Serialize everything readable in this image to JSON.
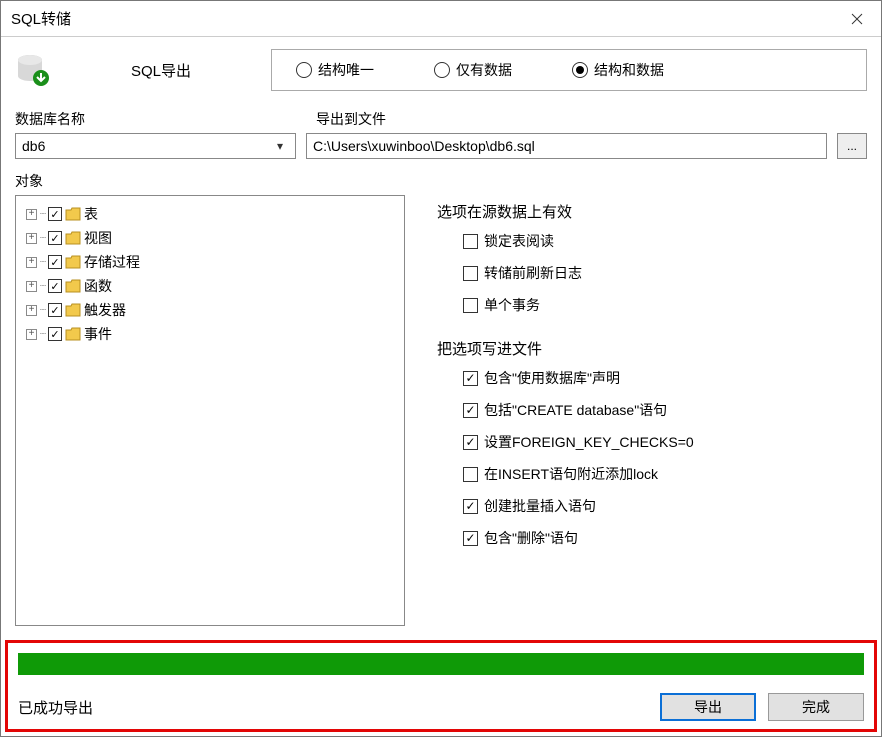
{
  "window": {
    "title": "SQL转储"
  },
  "header": {
    "export_label": "SQL导出",
    "radios": [
      {
        "label": "结构唯一",
        "selected": false
      },
      {
        "label": "仅有数据",
        "selected": false
      },
      {
        "label": "结构和数据",
        "selected": true
      }
    ]
  },
  "labels": {
    "dbname": "数据库名称",
    "filepath": "导出到文件",
    "objects": "对象"
  },
  "db_select": {
    "value": "db6"
  },
  "file": {
    "path": "C:\\Users\\xuwinboo\\Desktop\\db6.sql",
    "browse": "..."
  },
  "tree": {
    "items": [
      {
        "label": "表"
      },
      {
        "label": "视图"
      },
      {
        "label": "存储过程"
      },
      {
        "label": "函数"
      },
      {
        "label": "触发器"
      },
      {
        "label": "事件"
      }
    ]
  },
  "options": {
    "group1_title": "选项在源数据上有效",
    "group1": [
      {
        "label": "锁定表阅读",
        "checked": false
      },
      {
        "label": "转储前刷新日志",
        "checked": false
      },
      {
        "label": "单个事务",
        "checked": false
      }
    ],
    "group2_title": "把选项写进文件",
    "group2": [
      {
        "label": "包含\"使用数据库\"声明",
        "checked": true
      },
      {
        "label": "包括\"CREATE database\"语句",
        "checked": true
      },
      {
        "label": "设置FOREIGN_KEY_CHECKS=0",
        "checked": true
      },
      {
        "label": "在INSERT语句附近添加lock",
        "checked": false
      },
      {
        "label": "创建批量插入语句",
        "checked": true
      },
      {
        "label": "包含\"删除\"语句",
        "checked": true
      }
    ]
  },
  "status": {
    "message": "已成功导出",
    "export_btn": "导出",
    "done_btn": "完成"
  }
}
